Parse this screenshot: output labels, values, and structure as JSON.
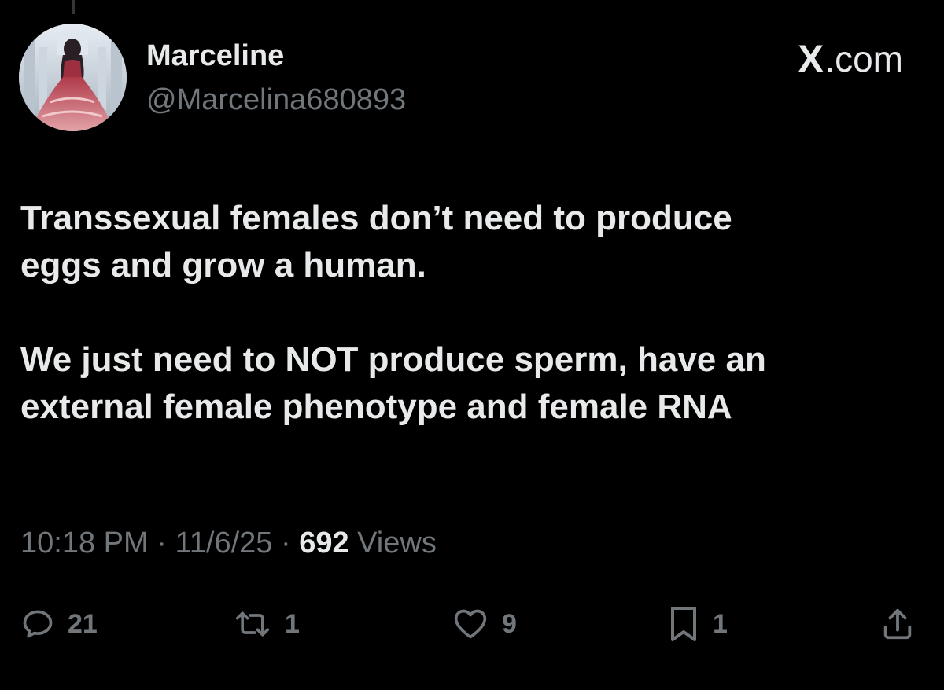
{
  "author": {
    "display_name": "Marceline",
    "handle": "@Marcelina680893",
    "avatar_icon": "avatar-princess-gown"
  },
  "site": {
    "logo_icon": "x-logo-icon",
    "logo_text": "X",
    "domain_suffix": ".com"
  },
  "tweet": {
    "paragraphs": [
      "Transsexual females don’t need to produce\neggs and grow a human.",
      "We just need to NOT produce sperm, have an\nexternal female phenotype and female RNA"
    ]
  },
  "meta": {
    "time": "10:18 PM",
    "separator": " · ",
    "date": "11/6/25",
    "views_count": "692",
    "views_label": " Views"
  },
  "actions": {
    "reply_icon": "reply-icon",
    "reply_count": "21",
    "retweet_icon": "retweet-icon",
    "retweet_count": "1",
    "like_icon": "heart-icon",
    "like_count": "9",
    "bookmark_icon": "bookmark-icon",
    "bookmark_count": "1",
    "share_icon": "share-icon"
  },
  "colors": {
    "background": "#000000",
    "primary_text": "#e7e9ea",
    "secondary_text": "#71767b"
  }
}
